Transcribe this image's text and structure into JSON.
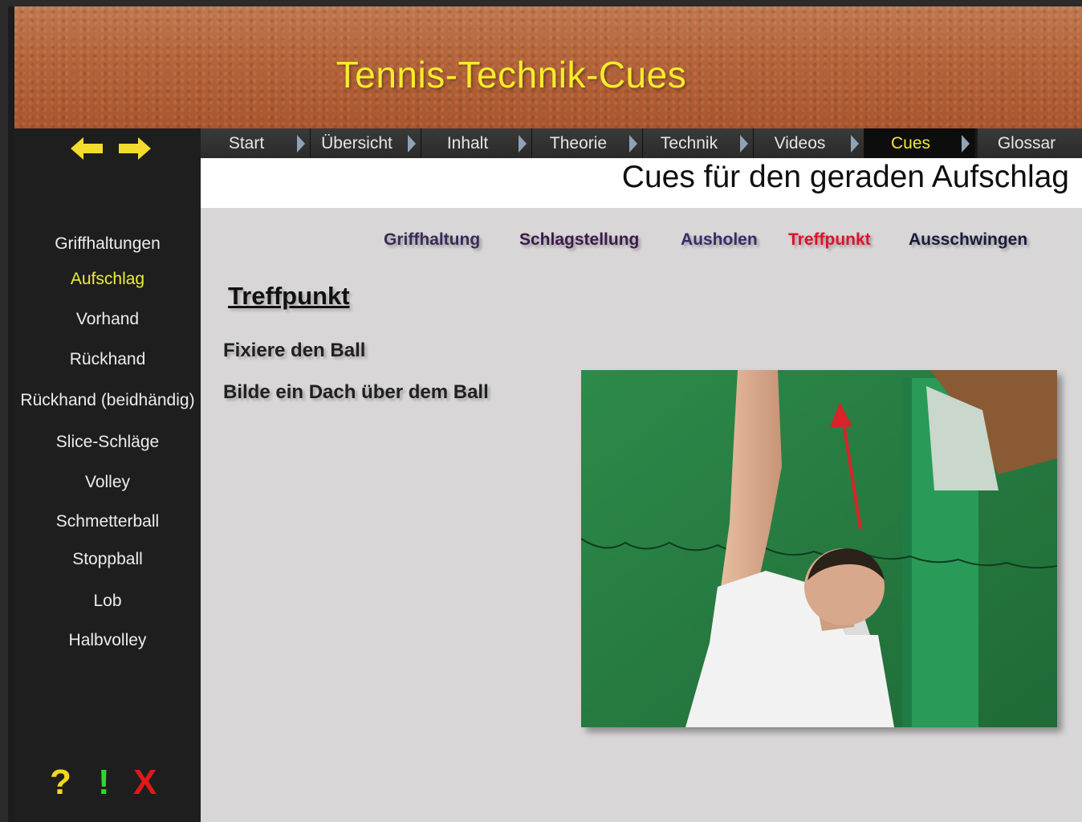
{
  "header": {
    "title": "Tennis-Technik-Cues"
  },
  "nav": {
    "tabs": [
      {
        "label": "Start",
        "active": false
      },
      {
        "label": "Übersicht",
        "active": false
      },
      {
        "label": "Inhalt",
        "active": false
      },
      {
        "label": "Theorie",
        "active": false
      },
      {
        "label": "Technik",
        "active": false
      },
      {
        "label": "Videos",
        "active": false
      },
      {
        "label": "Cues",
        "active": true
      },
      {
        "label": "Glossar",
        "active": false
      }
    ]
  },
  "page_title": "Cues für den geraden Aufschlag",
  "sidebar": {
    "items": [
      {
        "label": "Griffhaltungen",
        "active": false
      },
      {
        "label": "Aufschlag",
        "active": true
      },
      {
        "label": "Vorhand",
        "active": false
      },
      {
        "label": "Rückhand",
        "active": false
      },
      {
        "label": "Rückhand (beidhändig)",
        "active": false
      },
      {
        "label": "Slice-Schläge",
        "active": false
      },
      {
        "label": "Volley",
        "active": false
      },
      {
        "label": "Schmetterball",
        "active": false
      },
      {
        "label": "Stoppball",
        "active": false
      },
      {
        "label": "Lob",
        "active": false
      },
      {
        "label": "Halbvolley",
        "active": false
      }
    ],
    "nav_icons": [
      "arrow-left-icon",
      "arrow-right-icon"
    ],
    "bottom": {
      "help": "?",
      "info": "!",
      "close": "X"
    }
  },
  "subnav": {
    "items": [
      {
        "label": "Griffhaltung",
        "color": "#3a2a5a"
      },
      {
        "label": "Schlagstellung",
        "color": "#3a1a4a"
      },
      {
        "label": "Ausholen",
        "color": "#3a2a6a"
      },
      {
        "label": "Treffpunkt",
        "color": "#e0102a"
      },
      {
        "label": "Ausschwingen",
        "color": "#1a1a3a"
      }
    ]
  },
  "section": {
    "title": "Treffpunkt",
    "cues": [
      "Fixiere den Ball",
      "Bilde ein Dach über dem Ball"
    ]
  },
  "colors": {
    "accent_yellow": "#f6ec2c",
    "active_red": "#e0102a",
    "sidebar_bg": "#1e1e1e",
    "content_bg": "#d8d6d6"
  }
}
